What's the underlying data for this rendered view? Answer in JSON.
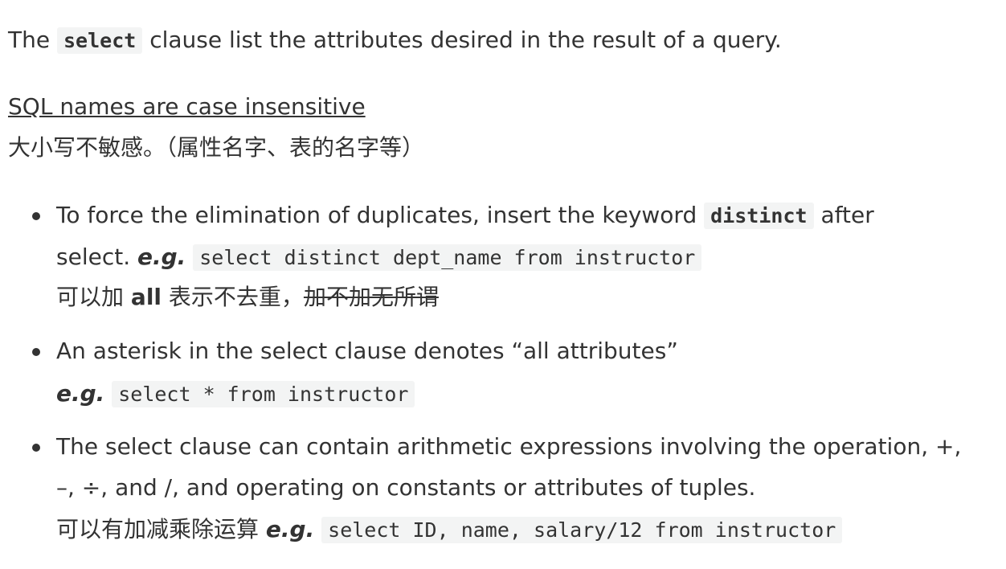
{
  "intro": {
    "prefix": "The",
    "keyword": "select",
    "suffix": "clause list the attributes desired in the result of a query."
  },
  "case_note": {
    "english": "SQL names are case insensitive",
    "chinese": "大小写不敏感。（属性名字、表的名字等）"
  },
  "bullets": [
    {
      "line1_prefix": "To force the elimination of duplicates, insert the keyword",
      "line1_keyword": "distinct",
      "line1_suffix": "after",
      "line2_text": "select.",
      "line2_eg": "e.g.",
      "line2_code": "select distinct dept_name from instructor",
      "line3_prefix": "可以加",
      "line3_bold": "all",
      "line3_middle": "表示不去重，",
      "line3_strike": "加不加无所谓"
    },
    {
      "line1_text": "An asterisk in the select clause denotes “all attributes”",
      "line2_eg": "e.g.",
      "line2_code": "select * from instructor"
    },
    {
      "line1_text": "The select clause can contain arithmetic expressions involving the operation, +,",
      "line2_text": "–, ÷, and /, and operating on constants or attributes of tuples.",
      "line3_prefix": "可以有加减乘除运算",
      "line3_eg": "e.g.",
      "line3_code": "select ID, name, salary/12 from instructor"
    }
  ]
}
